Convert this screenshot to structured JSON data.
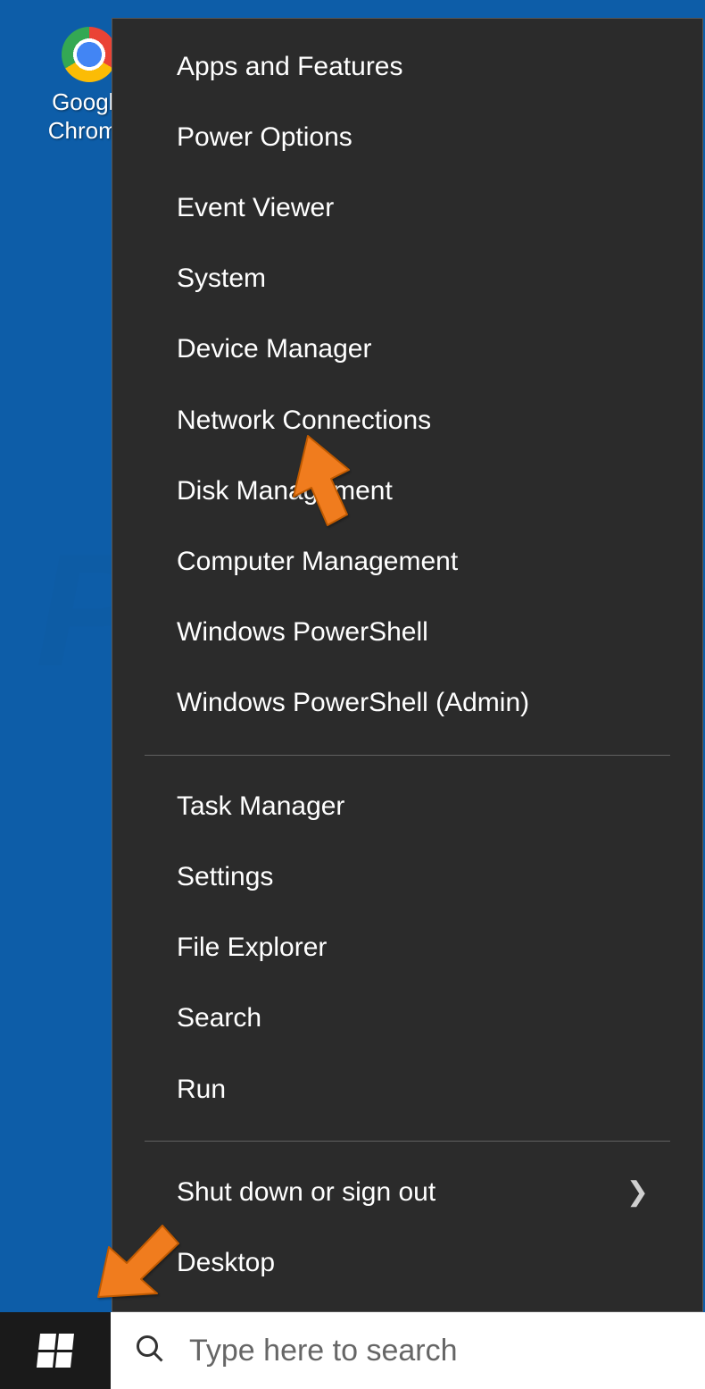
{
  "desktop": {
    "icon_label_line1": "Google",
    "icon_label_line2": "Chrome"
  },
  "winx_menu": {
    "group1": [
      "Apps and Features",
      "Power Options",
      "Event Viewer",
      "System",
      "Device Manager",
      "Network Connections",
      "Disk Management",
      "Computer Management",
      "Windows PowerShell",
      "Windows PowerShell (Admin)"
    ],
    "group2": [
      "Task Manager",
      "Settings",
      "File Explorer",
      "Search",
      "Run"
    ],
    "group3_submenu": "Shut down or sign out",
    "group3_last": "Desktop"
  },
  "taskbar": {
    "search_placeholder": "Type here to search"
  },
  "annotation": {
    "arrow1_target": "Network Connections",
    "arrow2_target": "Start button"
  },
  "watermark_text": "PCrisk.com"
}
